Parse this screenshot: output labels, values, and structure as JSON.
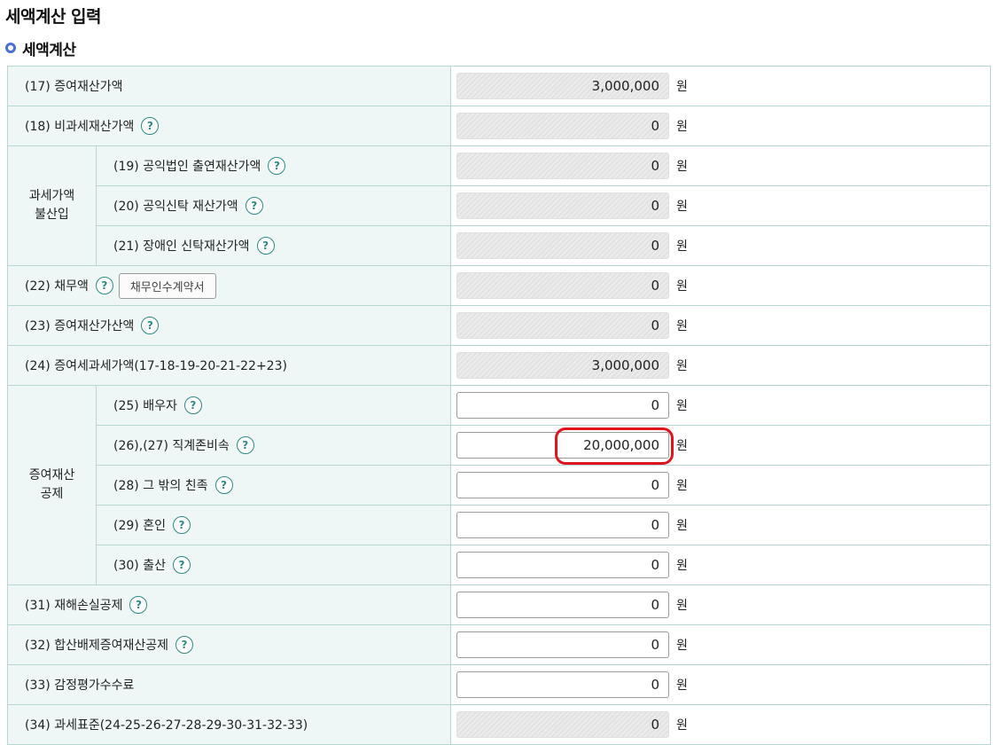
{
  "page_title": "세액계산 입력",
  "section_title": "세액계산",
  "unit": "원",
  "help_glyph": "?",
  "accent_colors": {
    "header_bg": "#eef7f6",
    "border": "#b7d7d5",
    "help_icon": "#2b8a84",
    "bullet": "#4a6fd6",
    "highlight": "#e0141f"
  },
  "groups": {
    "exclusion": "과세가액\n불산입",
    "deduction": "증여재산\n공제"
  },
  "debt_button": "채무인수계약서",
  "rows": [
    {
      "label": "(17) 증여재산가액",
      "value": "3,000,000",
      "readonly": true,
      "help": false
    },
    {
      "label": "(18) 비과세재산가액",
      "value": "0",
      "readonly": true,
      "help": true
    },
    {
      "label": "(19) 공익법인 출연재산가액",
      "value": "0",
      "readonly": true,
      "help": true
    },
    {
      "label": "(20) 공익신탁 재산가액",
      "value": "0",
      "readonly": true,
      "help": true
    },
    {
      "label": "(21) 장애인 신탁재산가액",
      "value": "0",
      "readonly": true,
      "help": true
    },
    {
      "label": "(22) 채무액",
      "value": "0",
      "readonly": true,
      "help": true
    },
    {
      "label": "(23) 증여재산가산액",
      "value": "0",
      "readonly": true,
      "help": true
    },
    {
      "label": "(24) 증여세과세가액(17-18-19-20-21-22+23)",
      "value": "3,000,000",
      "readonly": true,
      "help": false
    },
    {
      "label": "(25) 배우자",
      "value": "0",
      "readonly": false,
      "help": true
    },
    {
      "label": "(26),(27) 직계존비속",
      "value": "20,000,000",
      "readonly": false,
      "help": true
    },
    {
      "label": "(28) 그 밖의 친족",
      "value": "0",
      "readonly": false,
      "help": true
    },
    {
      "label": "(29) 혼인",
      "value": "0",
      "readonly": false,
      "help": true
    },
    {
      "label": "(30) 출산",
      "value": "0",
      "readonly": false,
      "help": true
    },
    {
      "label": "(31) 재해손실공제",
      "value": "0",
      "readonly": false,
      "help": true
    },
    {
      "label": "(32) 합산배제증여재산공제",
      "value": "0",
      "readonly": false,
      "help": true
    },
    {
      "label": "(33) 감정평가수수료",
      "value": "0",
      "readonly": false,
      "help": false
    },
    {
      "label": "(34) 과세표준(24-25-26-27-28-29-30-31-32-33)",
      "value": "0",
      "readonly": true,
      "help": false
    }
  ]
}
